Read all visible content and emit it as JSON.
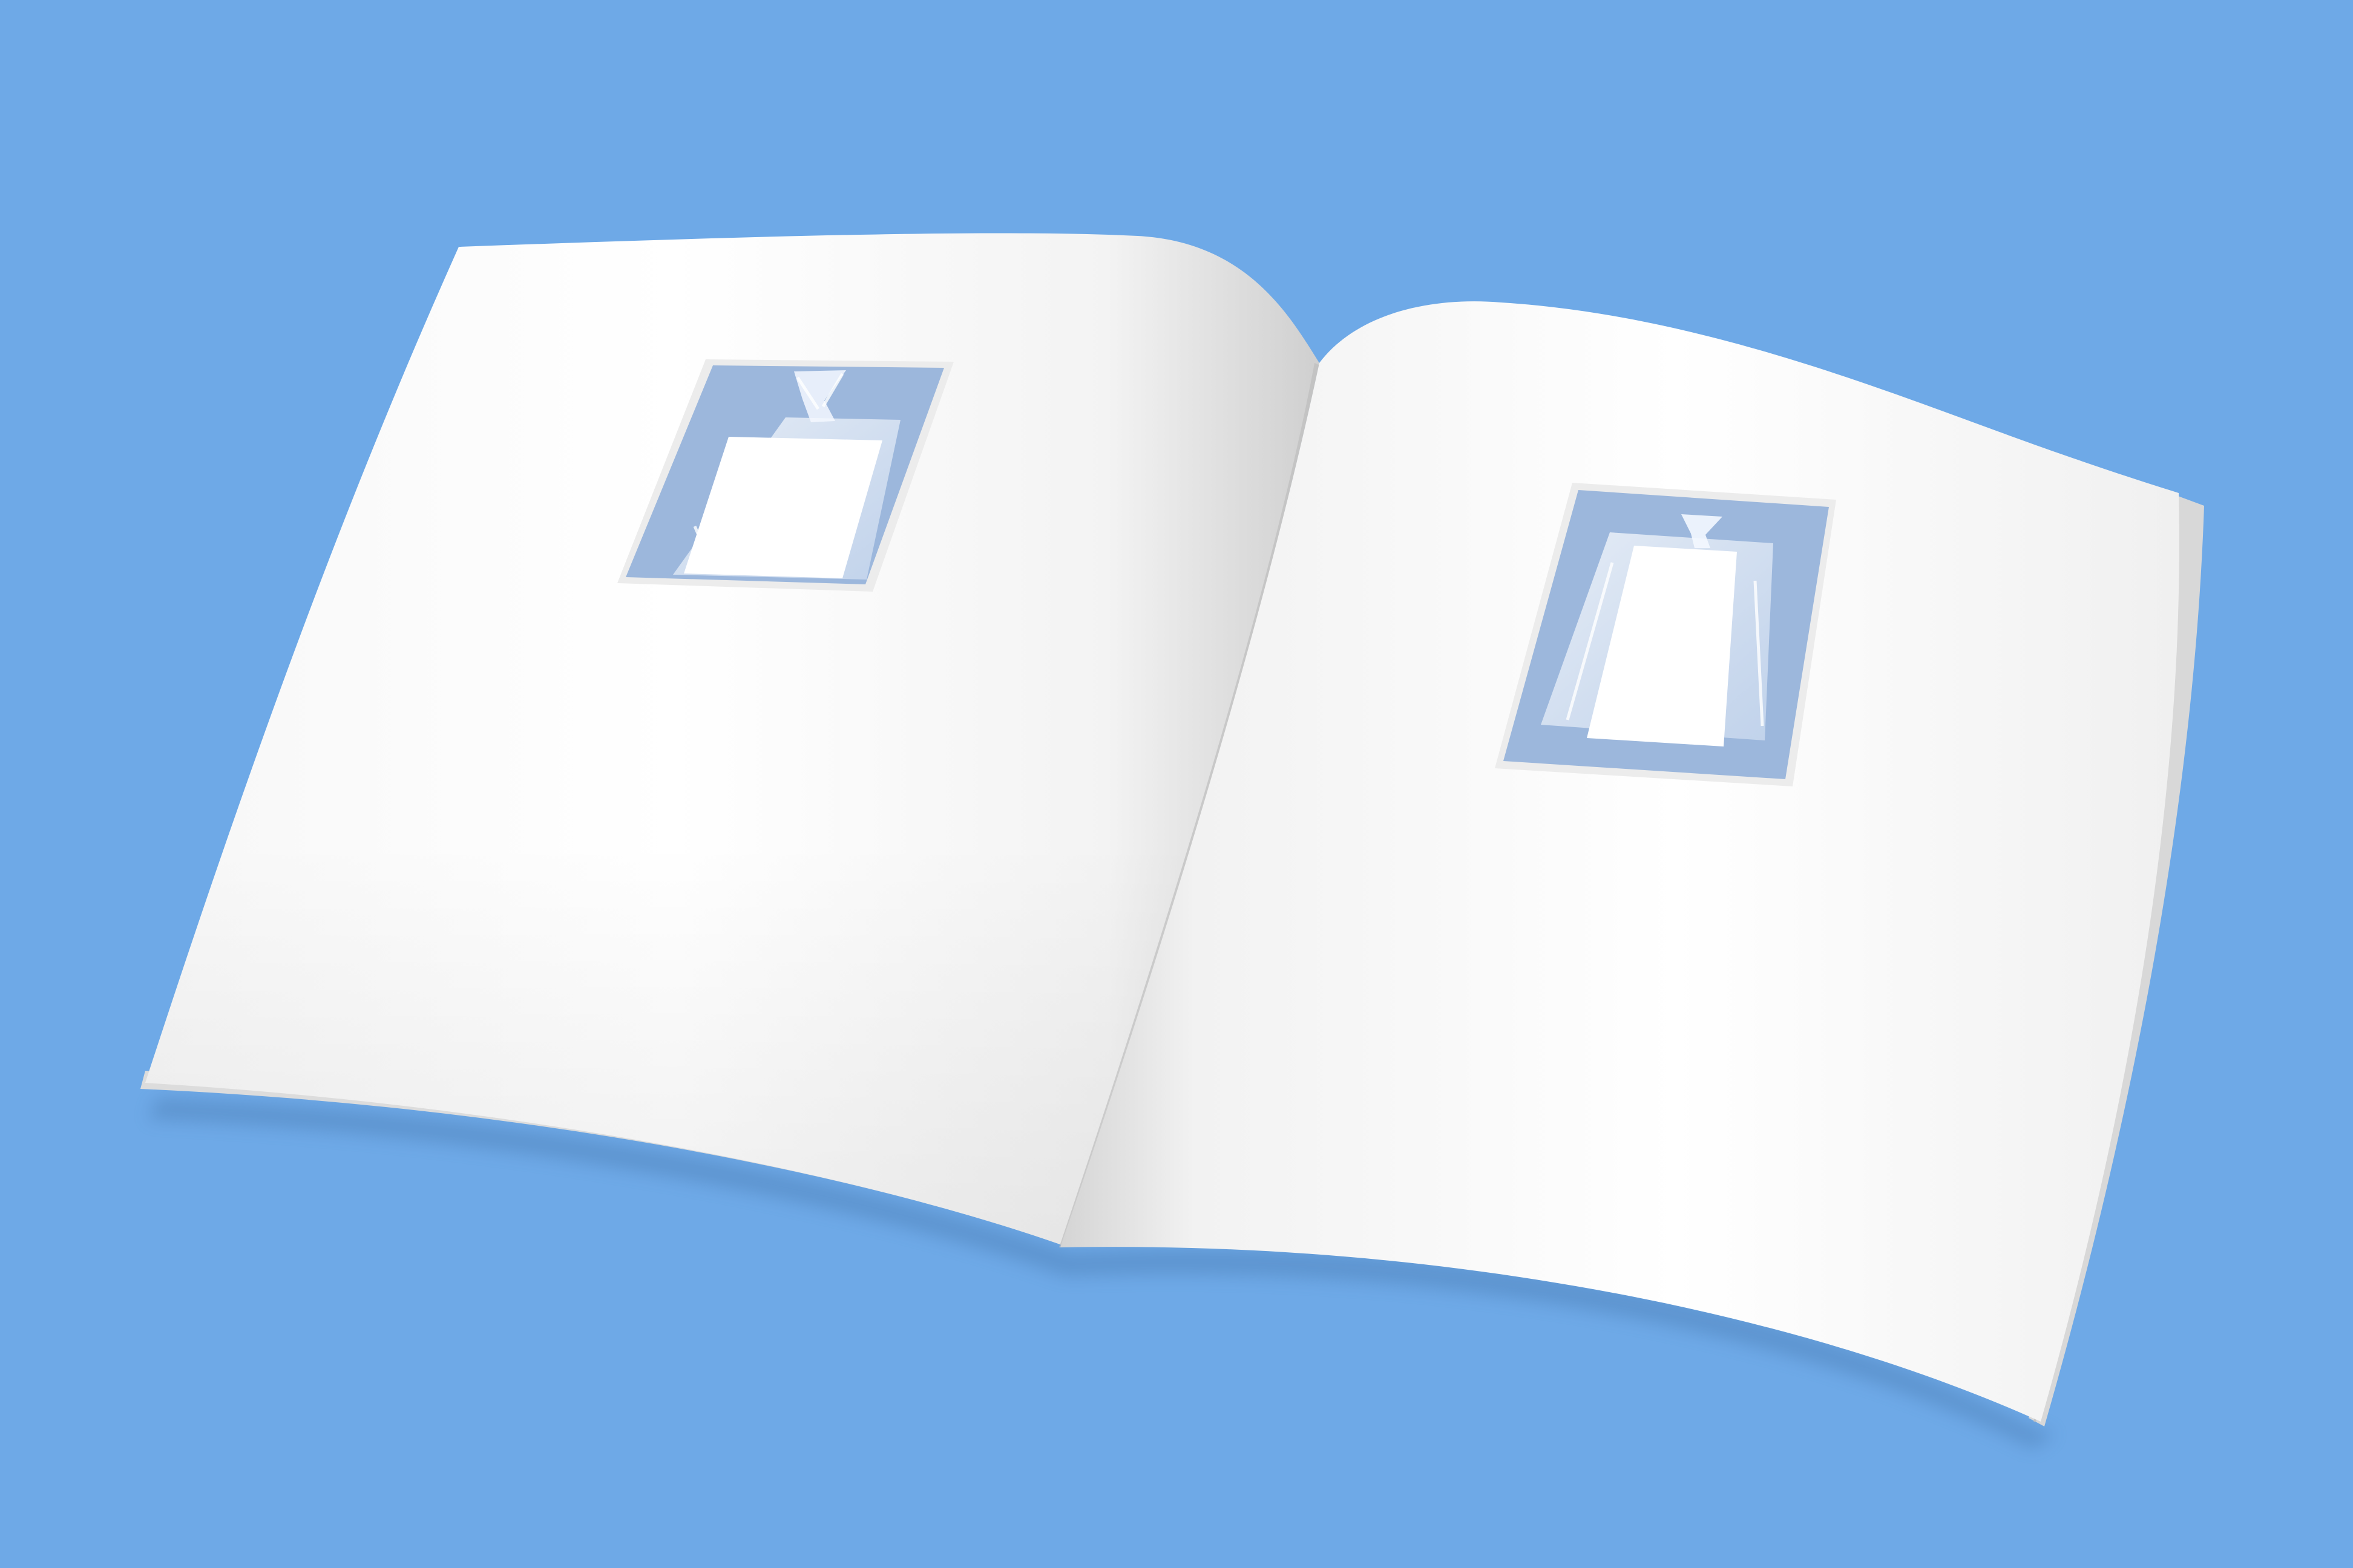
{
  "scene": {
    "subject": "",
    "caption": ""
  },
  "colors": {
    "background": "#6ea9e7",
    "page": "#ffffff",
    "page_shade": "#e2e2e2",
    "page_edge": "#dcdcdc",
    "photo_frame": "#ececec",
    "photo_backdrop": "#9cb7dc",
    "bag_highlight": "#f4f8ff",
    "blank_square": "#ffffff"
  },
  "spread": {
    "left_page": {
      "text": "",
      "photo": {
        "depicts": "clear-plastic-bag-with-white-square"
      }
    },
    "right_page": {
      "text": "",
      "photo": {
        "depicts": "clear-plastic-bag-with-white-square"
      }
    }
  }
}
